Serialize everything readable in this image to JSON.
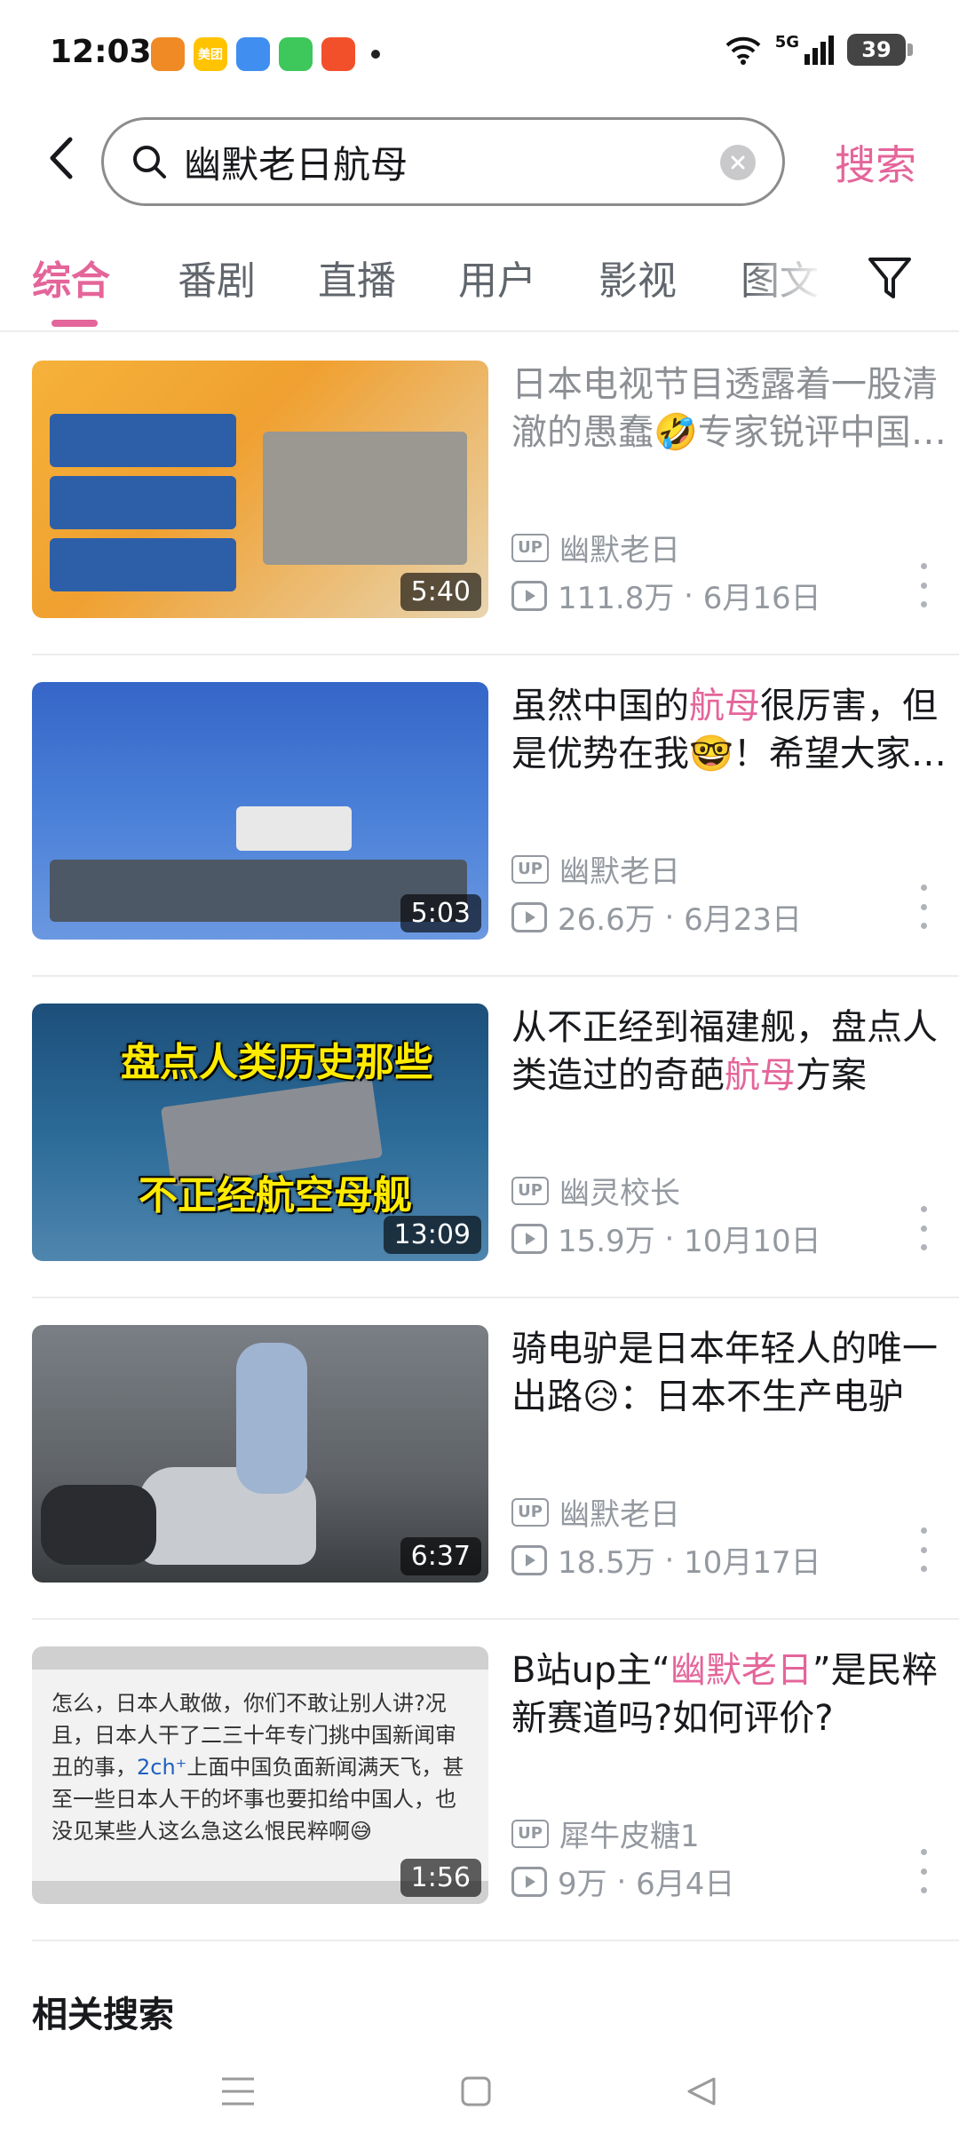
{
  "status_bar": {
    "time": "12:03",
    "apps": [
      {
        "icon": "home-app-icon",
        "color": "#f08a24",
        "label": ""
      },
      {
        "icon": "meituan-app-icon",
        "color": "#ffc300",
        "label": "美团"
      },
      {
        "icon": "browser-app-icon",
        "color": "#3f8ef0",
        "label": ""
      },
      {
        "icon": "message-app-icon",
        "color": "#3ec75a",
        "label": ""
      },
      {
        "icon": "video-app-icon",
        "color": "#f2502a",
        "label": ""
      }
    ],
    "network": "5G",
    "battery": "39"
  },
  "search": {
    "query": "幽默老日航母",
    "submit_label": "搜索"
  },
  "tabs": [
    {
      "label": "综合",
      "active": true
    },
    {
      "label": "番剧",
      "active": false
    },
    {
      "label": "直播",
      "active": false
    },
    {
      "label": "用户",
      "active": false
    },
    {
      "label": "影视",
      "active": false
    },
    {
      "label": "图文",
      "active": false
    }
  ],
  "results": [
    {
      "title": "日本电视节目透露着一股清澈的愚蠢🤣专家锐评中国航母",
      "title_parts": [
        {
          "text": "日本电视节目透露着一股清澈的愚蠢🤣专家锐评中国航母",
          "hl": false
        }
      ],
      "faded": true,
      "duration": "5:40",
      "author": "幽默老日",
      "views": "111.8万",
      "date": "6月16日",
      "thumb_class": "t1"
    },
    {
      "title": "虽然中国的航母很厉害，但是优势在我🤓！希望...",
      "title_parts": [
        {
          "text": "虽然中国的",
          "hl": false
        },
        {
          "text": "航母",
          "hl": true
        },
        {
          "text": "很厉害，但是优势在我🤓！希望大家理性看待",
          "hl": false
        }
      ],
      "faded": false,
      "duration": "5:03",
      "author": "幽默老日",
      "views": "26.6万",
      "date": "6月23日",
      "thumb_class": "t2"
    },
    {
      "title": "从不正经到福建舰，盘点人类造过的奇葩航母方案",
      "title_parts": [
        {
          "text": "从不正经到福建舰，盘点人类造过的奇葩",
          "hl": false
        },
        {
          "text": "航母",
          "hl": true
        },
        {
          "text": "方案",
          "hl": false
        }
      ],
      "faded": false,
      "duration": "13:09",
      "author": "幽灵校长",
      "views": "15.9万",
      "date": "10月10日",
      "thumb_class": "t3"
    },
    {
      "title": "骑电驴是日本年轻人的唯一出路😥：日本不生产电驴",
      "title_parts": [
        {
          "text": "骑电驴是日本年轻人的唯一出路😥：日本不生产电驴",
          "hl": false
        }
      ],
      "faded": false,
      "duration": "6:37",
      "author": "幽默老日",
      "views": "18.5万",
      "date": "10月17日",
      "thumb_class": "t4"
    },
    {
      "title": "B站up主“幽默老日”是民粹新赛道吗?如何评价?",
      "title_parts": [
        {
          "text": "B站up主“",
          "hl": false
        },
        {
          "text": "幽默老日",
          "hl": true
        },
        {
          "text": "”是民粹新赛道吗?如何评价?",
          "hl": false
        }
      ],
      "faded": false,
      "duration": "1:56",
      "author": "犀牛皮糖1",
      "views": "9万",
      "date": "6月4日",
      "thumb_class": "t5"
    }
  ],
  "thumb_text": {
    "t3_top": "盘点人类历史那些",
    "t3_bottom": "不正经航空母舰",
    "t5_quote": "怎么，日本人敢做，你们不敢让别人讲?况且，日本人干了二三十年专门挑中国新闻审丑的事，",
    "t5_quote_blue": "2ch⁺",
    "t5_quote_tail": "上面中国负面新闻满天飞，甚至一些日本人干的坏事也要扣给中国人，也没见某些人这么急这么恨民粹啊😅"
  },
  "related_search_label": "相关搜索",
  "colors": {
    "accent": "#e4659a",
    "meta": "#9499a0"
  }
}
